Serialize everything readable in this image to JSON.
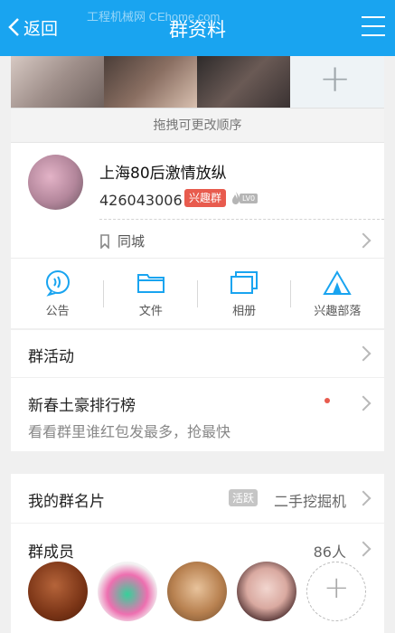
{
  "header": {
    "back_label": "返回",
    "title": "群资料",
    "watermark": "工程机械网 CEhome.com"
  },
  "photos": {
    "add_label": "+",
    "drag_tip": "拖拽可更改顺序"
  },
  "group": {
    "name": "上海80后激情放纵",
    "id": "426043006",
    "badge": "兴趣群",
    "level": "LV0",
    "location": "同城"
  },
  "tools": [
    {
      "label": "公告"
    },
    {
      "label": "文件"
    },
    {
      "label": "相册"
    },
    {
      "label": "兴趣部落"
    }
  ],
  "rows": {
    "activity": "群活动",
    "ranking_title": "新春土豪排行榜",
    "ranking_sub": "看看群里谁红包发最多，抢最快",
    "my_card_label": "我的群名片",
    "my_card_tag": "活跃",
    "my_card_value": "二手挖掘机",
    "members_label": "群成员",
    "members_count": "86人"
  },
  "colors": {
    "accent": "#19a4f0",
    "badge_red": "#e85b4e"
  }
}
